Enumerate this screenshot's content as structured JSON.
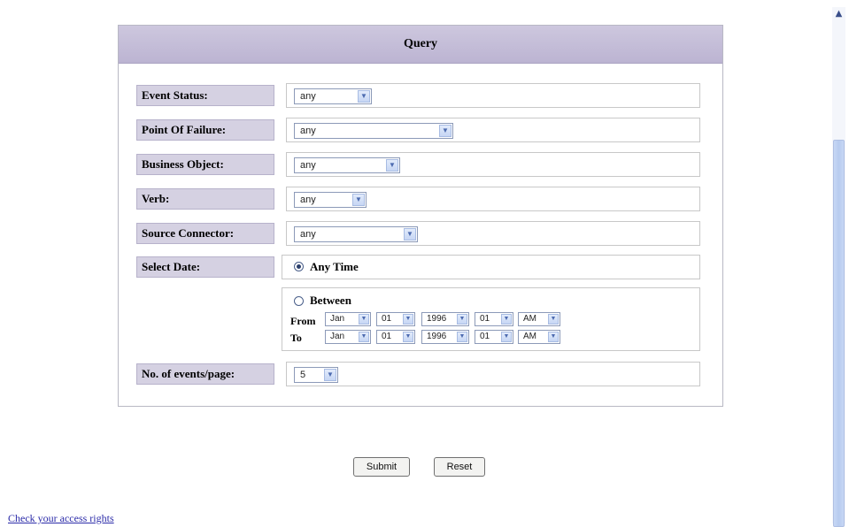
{
  "panel": {
    "title": "Query"
  },
  "fields": [
    {
      "label": "Event Status:",
      "value": "any"
    },
    {
      "label": "Point Of Failure:",
      "value": "any"
    },
    {
      "label": "Business Object:",
      "value": "any"
    },
    {
      "label": "Verb:",
      "value": "any"
    },
    {
      "label": "Source Connector:",
      "value": "any"
    }
  ],
  "select_date": {
    "label": "Select Date:",
    "option_any": "Any Time",
    "option_between": "Between",
    "selected": "Any Time",
    "from_label": "From",
    "to_label": "To",
    "from": {
      "month": "Jan",
      "day": "01",
      "year": "1996",
      "hour": "01",
      "ampm": "AM"
    },
    "to": {
      "month": "Jan",
      "day": "01",
      "year": "1996",
      "hour": "01",
      "ampm": "AM"
    }
  },
  "events_per_page": {
    "label": "No. of events/page:",
    "value": "5"
  },
  "buttons": {
    "submit": "Submit",
    "reset": "Reset"
  },
  "footer": {
    "link": "Check your access rights"
  },
  "icons": {
    "dropdown": "chevron-down-icon",
    "scroll_up": "scroll-up-arrow-icon"
  }
}
